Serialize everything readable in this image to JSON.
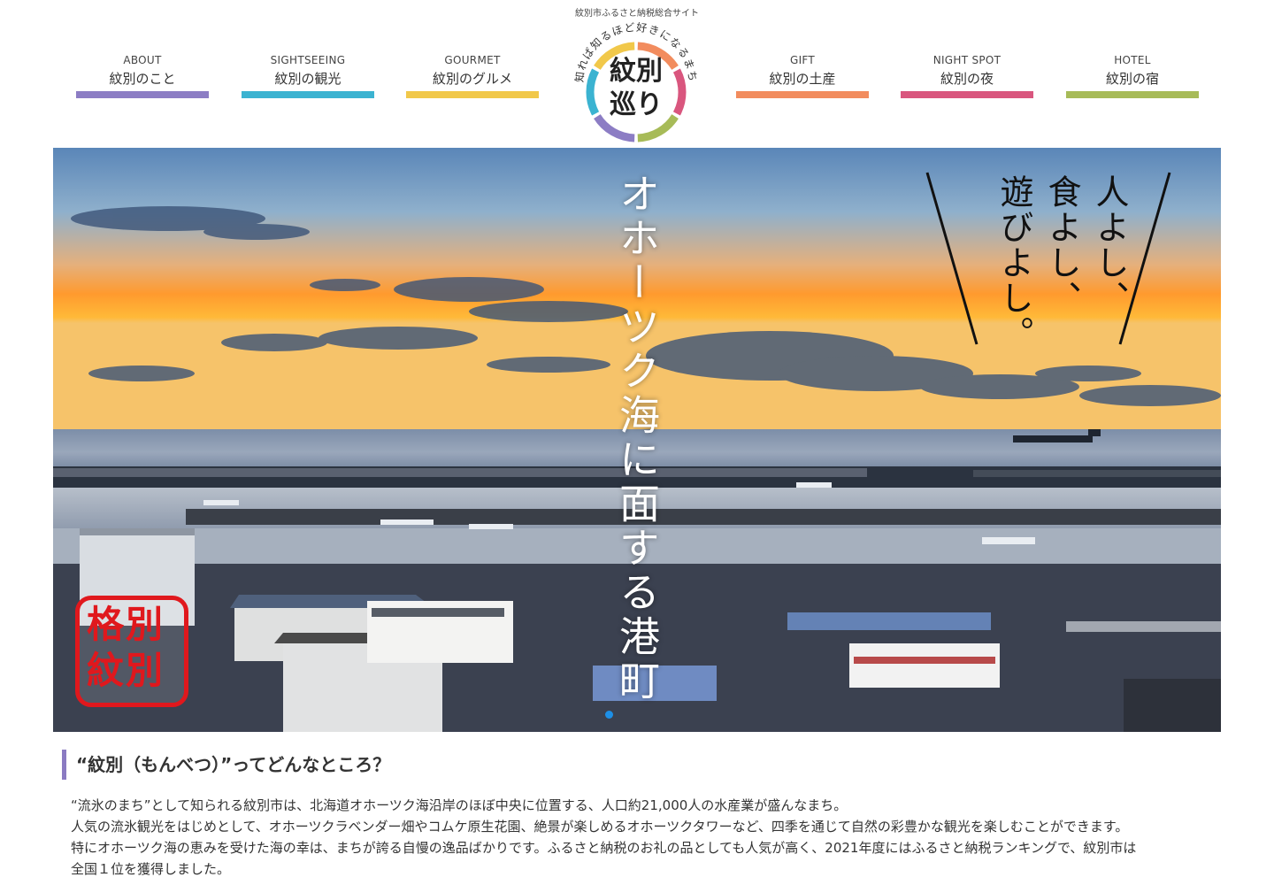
{
  "header": {
    "tagline": "紋別市ふるさと納税総合サイト",
    "logo": {
      "main_line1": "紋別",
      "main_line2": "巡り",
      "arc_text": "知れば知るほど好きになるまち",
      "ring_colors": [
        "#8c7dc4",
        "#3bb3d1",
        "#f1c84a",
        "#f28c5e",
        "#d9567e",
        "#a7bb58"
      ]
    }
  },
  "nav": [
    {
      "en": "ABOUT",
      "jp": "紋別のこと",
      "color": "#8c7dc4"
    },
    {
      "en": "SIGHTSEEING",
      "jp": "紋別の観光",
      "color": "#3bb3d1"
    },
    {
      "en": "GOURMET",
      "jp": "紋別のグルメ",
      "color": "#f1c84a"
    },
    {
      "en": "GIFT",
      "jp": "紋別の土産",
      "color": "#f28c5e"
    },
    {
      "en": "NIGHT SPOT",
      "jp": "紋別の夜",
      "color": "#d9567e"
    },
    {
      "en": "HOTEL",
      "jp": "紋別の宿",
      "color": "#a7bb58"
    }
  ],
  "hero": {
    "vertical_text": "オホーツク海に面する港町",
    "motto": [
      "人よし、",
      "食よし、",
      "遊びよし。"
    ],
    "stamp": {
      "line1": "格別",
      "line2": "紋別"
    },
    "slider_dot_color": "#1d8fe6"
  },
  "about": {
    "heading": "“紋別（もんべつ）”ってどんなところ？",
    "accent_color": "#8b7bc2",
    "paragraphs": [
      "“流氷のまち”として知られる紋別市は、北海道オホーツク海沿岸のほぼ中央に位置する、人口約21,000人の水産業が盛んなまち。",
      "人気の流氷観光をはじめとして、オホーツクラベンダー畑やコムケ原生花園、絶景が楽しめるオホーツクタワーなど、四季を通じて自然の彩豊かな観光を楽しむことができます。",
      "特にオホーツク海の恵みを受けた海の幸は、まちが誇る自慢の逸品ばかりです。ふるさと納税のお礼の品としても人気が高く、2021年度にはふるさと納税ランキングで、紋別市は",
      "全国１位を獲得しました。"
    ]
  }
}
